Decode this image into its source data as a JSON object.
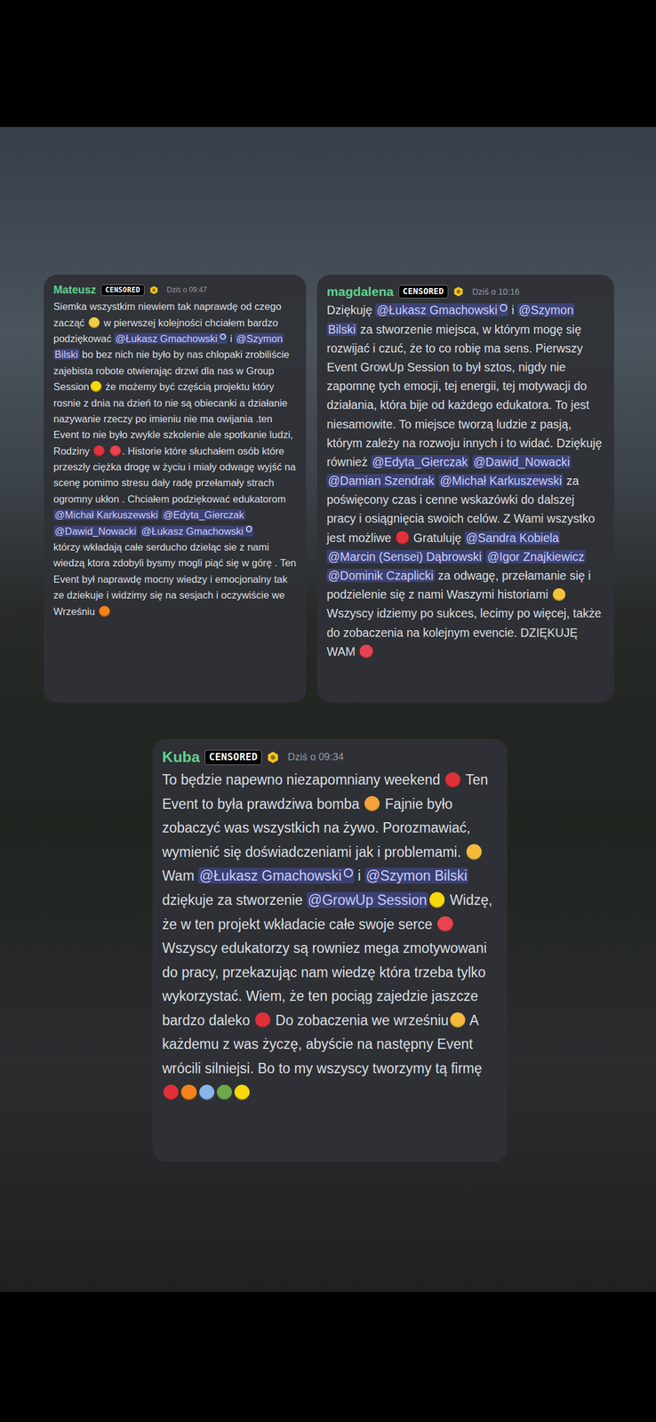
{
  "messages": [
    {
      "author": "Mateusz",
      "censor": "CENSORED",
      "time": "Dziś o 09:47",
      "content": [
        {
          "kind": "text",
          "text": "Siemka wszystkim niewiem tak naprawdę od czego zacząć "
        },
        {
          "kind": "emoji",
          "color": "#f7c948"
        },
        {
          "kind": "text",
          "text": " w pierwszej kolejności chciałem bardzo podziękować "
        },
        {
          "kind": "mention",
          "text": "@Łukasz Gmachowski",
          "badge": true
        },
        {
          "kind": "text",
          "text": " i "
        },
        {
          "kind": "mention",
          "text": "@Szymon Bilski",
          "badge": false
        },
        {
          "kind": "text",
          "text": " bo bez nich nie było by nas chlopaki zrobiliście zajebista robote otwierając drzwi dla nas w Group Session"
        },
        {
          "kind": "emoji",
          "color": "#f5d90a"
        },
        {
          "kind": "text",
          "text": " że możemy być częścią projektu który rosnie z dnia na dzień to nie są obiecanki a działanie nazywanie rzeczy po imieniu nie ma owijania .ten Event to nie było zwykle szkolenie ale spotkanie ludzi, Rodziny "
        },
        {
          "kind": "emoji",
          "color": "#e5303c"
        },
        {
          "kind": "text",
          "text": " "
        },
        {
          "kind": "emoji",
          "color": "#e8434f"
        },
        {
          "kind": "text",
          "text": ". Historie które słuchałem osób które przeszły ciężka drogę w życiu i miały odwagę wyjść na scenę pomimo stresu dały radę przełamały strach ogromny ukłon . Chciałem podziękować edukatorom "
        },
        {
          "kind": "mention",
          "text": "@Michał Karkuszewski",
          "badge": false
        },
        {
          "kind": "text",
          "text": " "
        },
        {
          "kind": "mention",
          "text": "@Edyta_Gierczak",
          "badge": false
        },
        {
          "kind": "text",
          "text": " "
        },
        {
          "kind": "mention",
          "text": "@Dawid_Nowacki",
          "badge": false
        },
        {
          "kind": "text",
          "text": " "
        },
        {
          "kind": "mention",
          "text": "@Łukasz Gmachowski",
          "badge": true
        },
        {
          "kind": "text",
          "text": "\nktórzy wkładają całe serducho dzieląc sie z nami wiedzą ktora zdobyli bysmy mogli piąć się w górę . Ten Event był naprawdę mocny wiedzy i emocjonalny tak ze dziekuje i widzimy się na sesjach i oczywiście we Wrześniu "
        },
        {
          "kind": "emoji",
          "color": "#f7821b"
        }
      ]
    },
    {
      "author": "magdalena",
      "censor": "CENSORED",
      "time": "Dziś o 10:16",
      "content": [
        {
          "kind": "text",
          "text": "Dziękuję "
        },
        {
          "kind": "mention",
          "text": "@Łukasz Gmachowski",
          "badge": true
        },
        {
          "kind": "text",
          "text": " i "
        },
        {
          "kind": "mention",
          "text": "@Szymon Bilski",
          "badge": false
        },
        {
          "kind": "text",
          "text": " za stworzenie miejsca, w którym mogę się rozwijać i czuć, że to co robię ma sens. Pierwszy Event GrowUp Session to był sztos, nigdy nie zapomnę tych emocji, tej energii, tej motywacji do działania, która bije od każdego edukatora. To jest niesamowite. To miejsce tworzą ludzie z pasją, którym zależy na rozwoju innych i to widać. Dziękuję również "
        },
        {
          "kind": "mention",
          "text": "@Edyta_Gierczak",
          "badge": false
        },
        {
          "kind": "text",
          "text": " "
        },
        {
          "kind": "mention",
          "text": "@Dawid_Nowacki",
          "badge": false
        },
        {
          "kind": "text",
          "text": " "
        },
        {
          "kind": "mention",
          "text": "@Damian Szendrak",
          "badge": false
        },
        {
          "kind": "text",
          "text": " "
        },
        {
          "kind": "mention",
          "text": "@Michał Karkuszewski",
          "badge": false
        },
        {
          "kind": "text",
          "text": " za poświęcony czas i cenne wskazówki do dalszej pracy i osiągnięcia swoich celów. Z Wami wszystko jest możliwe "
        },
        {
          "kind": "emoji",
          "color": "#e5303c"
        },
        {
          "kind": "text",
          "text": " Gratuluję "
        },
        {
          "kind": "mention",
          "text": "@Sandra Kobiela",
          "badge": false
        },
        {
          "kind": "text",
          "text": " "
        },
        {
          "kind": "mention",
          "text": "@Marcin (Sensei) Dąbrowski",
          "badge": false
        },
        {
          "kind": "text",
          "text": " "
        },
        {
          "kind": "mention",
          "text": "@Igor Znajkiewicz",
          "badge": false
        },
        {
          "kind": "text",
          "text": " "
        },
        {
          "kind": "mention",
          "text": "@Dominik Czaplicki",
          "badge": false
        },
        {
          "kind": "text",
          "text": " za odwagę, przełamanie się i podzielenie się z nami Waszymi historiami "
        },
        {
          "kind": "emoji",
          "color": "#f5c23a"
        },
        {
          "kind": "text",
          "text": " Wszyscy idziemy po sukces, lecimy po więcej, także do zobaczenia na kolejnym evencie. DZIĘKUJĘ WAM "
        },
        {
          "kind": "emoji",
          "color": "#e8434f"
        }
      ]
    },
    {
      "author": "Kuba",
      "censor": "CENSORED",
      "time": "Dziś o 09:34",
      "content": [
        {
          "kind": "text",
          "text": "To będzie napewno niezapomniany weekend "
        },
        {
          "kind": "emoji",
          "color": "#e0303a"
        },
        {
          "kind": "text",
          "text": " Ten Event to była prawdziwa bomba "
        },
        {
          "kind": "emoji",
          "color": "#f2a33a"
        },
        {
          "kind": "text",
          "text": " Fajnie było zobaczyć was wszystkich na żywo. Porozmawiać, wymienić się doświadczeniami jak i problemami. "
        },
        {
          "kind": "emoji",
          "color": "#f5b93a"
        },
        {
          "kind": "text",
          "text": " Wam "
        },
        {
          "kind": "mention",
          "text": "@Łukasz Gmachowski",
          "badge": true
        },
        {
          "kind": "text",
          "text": " i "
        },
        {
          "kind": "mention",
          "text": "@Szymon Bilski",
          "badge": false
        },
        {
          "kind": "text",
          "text": " dziękuje za stworzenie "
        },
        {
          "kind": "mention",
          "text": "@GrowUp Session",
          "badge": false
        },
        {
          "kind": "emoji",
          "color": "#f5d90a"
        },
        {
          "kind": "text",
          "text": " Widzę, że w ten projekt wkładacie całe swoje serce "
        },
        {
          "kind": "emoji",
          "color": "#e8434f"
        },
        {
          "kind": "text",
          "text": " Wszyscy edukatorzy są rowniez mega zmotywowani do pracy, przekazując nam wiedzę która trzeba tylko wykorzystać. Wiem, że ten pociąg zajedzie jaszcze bardzo daleko "
        },
        {
          "kind": "emoji",
          "color": "#e0303a"
        },
        {
          "kind": "text",
          "text": " Do zobaczenia we wrześniu"
        },
        {
          "kind": "emoji",
          "color": "#f5b93a"
        },
        {
          "kind": "text",
          "text": " A każdemu z was życzę, abyście na następny Event wrócili silniejsi. Bo to my wszyscy tworzymy tą firmę "
        },
        {
          "kind": "emoji",
          "color": "#e0303a"
        },
        {
          "kind": "emoji",
          "color": "#f7821b"
        },
        {
          "kind": "emoji",
          "color": "#8ab4e8"
        },
        {
          "kind": "emoji",
          "color": "#6fa84a"
        },
        {
          "kind": "emoji",
          "color": "#f5d90a"
        }
      ]
    }
  ]
}
